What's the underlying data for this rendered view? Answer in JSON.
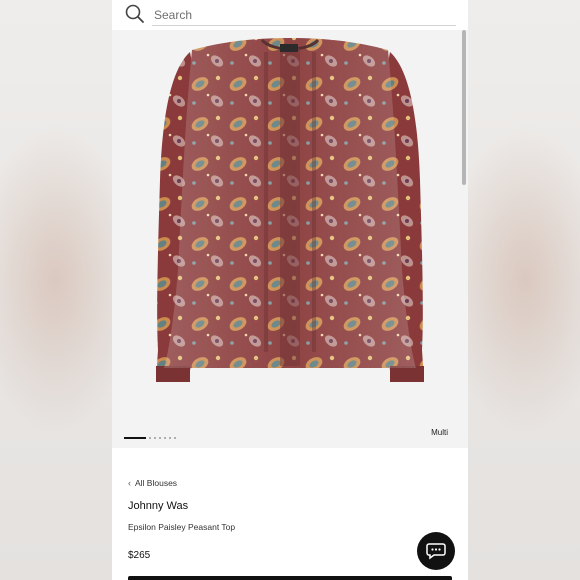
{
  "search": {
    "placeholder": "Search",
    "icon": "search-icon"
  },
  "gallery": {
    "color_label": "Multi",
    "total_images": 7,
    "active_index": 1,
    "image": "paisley-peasant-blouse"
  },
  "product": {
    "breadcrumb": "All Blouses",
    "brand": "Johnny Was",
    "name": "Epsilon Paisley Peasant Top",
    "price": "$265"
  },
  "chat": {
    "icon": "chat-bubble-icon"
  },
  "colors": {
    "accent": "#111111",
    "fabric_base": "#8a3a3a",
    "paisley_gold": "#d79a52",
    "paisley_teal": "#5a7f86"
  }
}
